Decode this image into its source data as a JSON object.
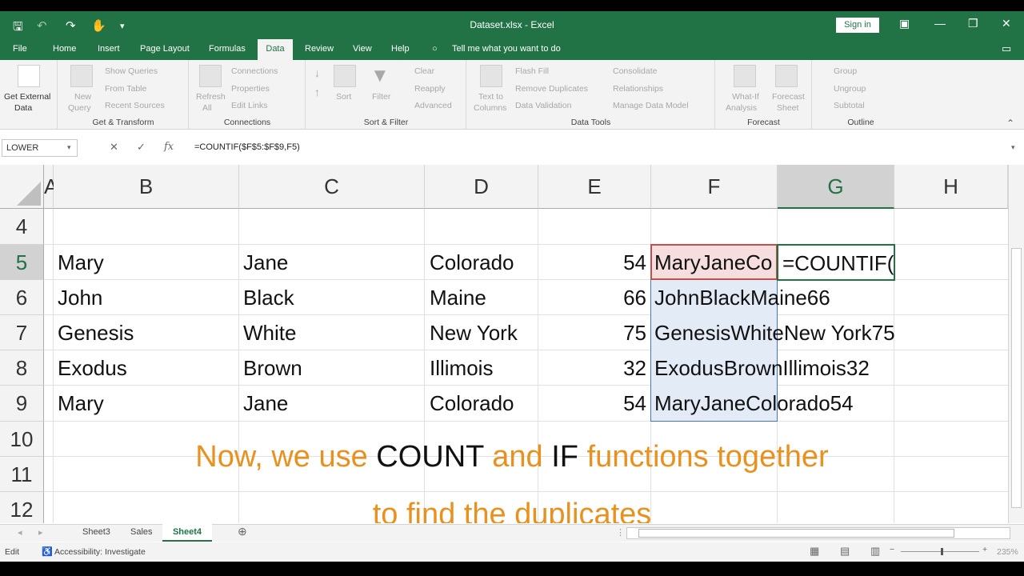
{
  "window": {
    "title": "Dataset.xlsx  -  Excel",
    "sign_in": "Sign in"
  },
  "tabs": [
    "File",
    "Home",
    "Insert",
    "Page Layout",
    "Formulas",
    "Data",
    "Review",
    "View",
    "Help"
  ],
  "active_tab": "Data",
  "tell_me": "Tell me what you want to do",
  "ribbon": {
    "get_external": "Get External",
    "get_external_2": "Data",
    "new_query": "New",
    "new_query_2": "Query",
    "show_queries": "Show Queries",
    "from_table": "From Table",
    "recent_sources": "Recent Sources",
    "get_transform": "Get & Transform",
    "refresh": "Refresh",
    "refresh_2": "All",
    "connections": "Connections",
    "properties": "Properties",
    "edit_links": "Edit Links",
    "connections_group": "Connections",
    "sort": "Sort",
    "filter": "Filter",
    "clear": "Clear",
    "reapply": "Reapply",
    "advanced": "Advanced",
    "sort_filter_group": "Sort & Filter",
    "text_to": "Text to",
    "columns": "Columns",
    "flash_fill": "Flash Fill",
    "remove_duplicates": "Remove Duplicates",
    "data_validation": "Data Validation",
    "consolidate": "Consolidate",
    "relationships": "Relationships",
    "manage_model": "Manage Data Model",
    "data_tools_group": "Data Tools",
    "what_if": "What-If",
    "what_if_2": "Analysis",
    "forecast_sheet": "Forecast",
    "forecast_sheet_2": "Sheet",
    "forecast_group": "Forecast",
    "group": "Group",
    "ungroup": "Ungroup",
    "subtotal": "Subtotal",
    "outline_group": "Outline"
  },
  "formula_bar": {
    "name_box": "LOWER",
    "formula": "=COUNTIF($F$5:$F$9,F5)"
  },
  "columns": [
    "A",
    "B",
    "C",
    "D",
    "E",
    "F",
    "G",
    "H"
  ],
  "rows": [
    "4",
    "5",
    "6",
    "7",
    "8",
    "9",
    "10",
    "11",
    "12"
  ],
  "cells": [
    {
      "b": "Mary",
      "c": "Jane",
      "d": "Colorado",
      "e": "54",
      "f": "MaryJaneCo",
      "g": "=COUNTIF("
    },
    {
      "b": "John",
      "c": "Black",
      "d": "Maine",
      "e": "66",
      "f": "JohnBlackMaine66",
      "g": ""
    },
    {
      "b": "Genesis",
      "c": "White",
      "d": "New York",
      "e": "75",
      "f": "GenesisWhiteNew York75",
      "g": ""
    },
    {
      "b": "Exodus",
      "c": "Brown",
      "d": "Illimois",
      "e": "32",
      "f": "ExodusBrownIllimois32",
      "g": ""
    },
    {
      "b": "Mary",
      "c": "Jane",
      "d": "Colorado",
      "e": "54",
      "f": "MaryJaneColorado54",
      "g": ""
    }
  ],
  "caption": {
    "line1_a": "Now, we use ",
    "line1_b": "COUNT",
    "line1_c": " and ",
    "line1_d": "IF",
    "line1_e": " functions together",
    "line2": "to find the duplicates"
  },
  "sheets": [
    "Sheet3",
    "Sales",
    "Sheet4"
  ],
  "active_sheet": "Sheet4",
  "status": {
    "mode": "Edit",
    "accessibility": "Accessibility: Investigate",
    "zoom": "235%"
  },
  "colors": {
    "accent": "#217346",
    "caption": "#e8911f"
  }
}
